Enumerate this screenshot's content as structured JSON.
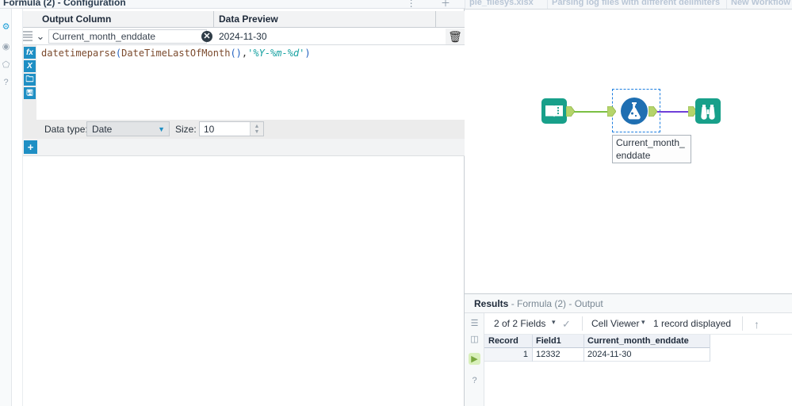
{
  "config": {
    "title": "Formula (2) - Configuration",
    "header_icons": "⋮ ＋",
    "rail_icons": [
      {
        "name": "gear-icon",
        "glyph": "⚙",
        "active": true
      },
      {
        "name": "eye-icon",
        "glyph": "◉",
        "active": false
      },
      {
        "name": "tag-icon",
        "glyph": "⬠",
        "active": false
      },
      {
        "name": "help-icon",
        "glyph": "?",
        "active": false
      }
    ],
    "columns": {
      "output_column": "Output Column",
      "data_preview": "Data Preview"
    },
    "row": {
      "output_name": "Current_month_enddate",
      "preview_value": "2024-11-30",
      "clear_icon": "✕",
      "chevron_icon": "⌄",
      "trash_icon": "🗑"
    },
    "formula_tools": [
      {
        "name": "fx-button",
        "label": "fx"
      },
      {
        "name": "variable-button",
        "label": "X"
      },
      {
        "name": "open-button",
        "label": "🗀"
      },
      {
        "name": "save-button",
        "label": "🖫"
      }
    ],
    "formula": {
      "fn1": "datetimeparse",
      "open1": "(",
      "fn2": "DateTimeLastOfMonth",
      "open2": "(",
      "close2": ")",
      "comma": ",",
      "format_string": "'%Y-%m-%d'",
      "close1": ")"
    },
    "data_type": {
      "label": "Data type:",
      "value": "Date",
      "caret": "▼"
    },
    "size": {
      "label": "Size:",
      "value": "10",
      "up": "▲",
      "down": "▼"
    },
    "add_button": "+"
  },
  "tabs": [
    {
      "label": "ple_filesys.xlsx",
      "close": "✕"
    },
    {
      "label": "Parsing log files with different delimiters",
      "close": "✕"
    },
    {
      "label": "New Workflow",
      "close": ""
    }
  ],
  "canvas": {
    "tools": [
      {
        "name": "text-input-tool",
        "icon": "book-icon"
      },
      {
        "name": "formula-tool",
        "icon": "flask-icon",
        "selected": true
      },
      {
        "name": "browse-tool",
        "icon": "binoculars-icon"
      }
    ],
    "tool_label": "Current_month_enddate"
  },
  "results": {
    "title_bold": "Results",
    "title_rest": " - Formula (2) - Output",
    "rail_icons": [
      {
        "name": "list-view-icon",
        "glyph": "☰"
      },
      {
        "name": "panel-icon",
        "glyph": "◫"
      },
      {
        "name": "output-anchor-icon",
        "glyph": "▶"
      },
      {
        "name": "help-icon",
        "glyph": "?"
      }
    ],
    "toolbar": {
      "fields": "2 of 2 Fields",
      "fields_caret": "▾",
      "check_icon": "✓",
      "viewer": "Cell Viewer",
      "viewer_caret": "▾",
      "record_count": "1 record displayed",
      "up_arrow": "↑"
    },
    "grid": {
      "headers": [
        "Record",
        "Field1",
        "Current_month_enddate"
      ],
      "rows": [
        {
          "record": "1",
          "field1": "12332",
          "enddate": "2024-11-30"
        }
      ]
    }
  },
  "colors": {
    "accent_blue": "#1f8fc4",
    "tool_teal": "#18a08a",
    "tool_blue": "#1f6fb2",
    "anchor_green": "#b5d46a",
    "link_green": "#7bc043",
    "link_purple": "#6f3fd8"
  }
}
